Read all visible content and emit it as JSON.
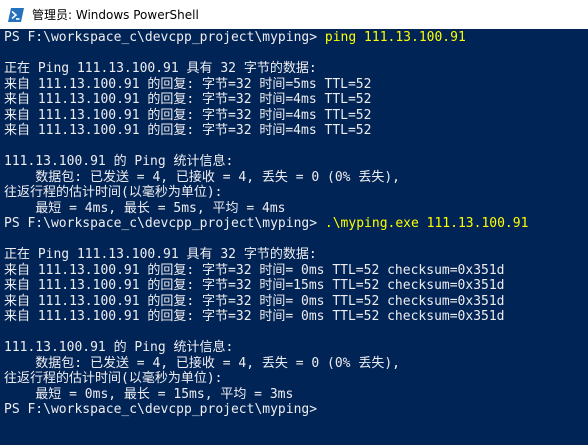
{
  "window": {
    "title": "管理员: Windows PowerShell",
    "icon": "powershell-icon",
    "colors": {
      "background": "#012456",
      "text": "#eeedf0",
      "command": "#ffff00"
    }
  },
  "console": {
    "lines": [
      {
        "prompt": "PS F:\\workspace_c\\devcpp_project\\myping>",
        "cmd": " ping 111.13.100.91"
      },
      {
        "text": ""
      },
      {
        "text": "正在 Ping 111.13.100.91 具有 32 字节的数据:"
      },
      {
        "text": "来自 111.13.100.91 的回复: 字节=32 时间=5ms TTL=52"
      },
      {
        "text": "来自 111.13.100.91 的回复: 字节=32 时间=4ms TTL=52"
      },
      {
        "text": "来自 111.13.100.91 的回复: 字节=32 时间=4ms TTL=52"
      },
      {
        "text": "来自 111.13.100.91 的回复: 字节=32 时间=4ms TTL=52"
      },
      {
        "text": ""
      },
      {
        "text": "111.13.100.91 的 Ping 统计信息:"
      },
      {
        "text": "    数据包: 已发送 = 4, 已接收 = 4, 丢失 = 0 (0% 丢失),"
      },
      {
        "text": "往返行程的估计时间(以毫秒为单位):"
      },
      {
        "text": "    最短 = 4ms, 最长 = 5ms, 平均 = 4ms"
      },
      {
        "prompt": "PS F:\\workspace_c\\devcpp_project\\myping>",
        "cmd": " .\\myping.exe 111.13.100.91"
      },
      {
        "text": ""
      },
      {
        "text": "正在 Ping 111.13.100.91 具有 32 字节的数据:"
      },
      {
        "text": "来自 111.13.100.91 的回复: 字节=32 时间= 0ms TTL=52 checksum=0x351d"
      },
      {
        "text": "来自 111.13.100.91 的回复: 字节=32 时间=15ms TTL=52 checksum=0x351d"
      },
      {
        "text": "来自 111.13.100.91 的回复: 字节=32 时间= 0ms TTL=52 checksum=0x351d"
      },
      {
        "text": "来自 111.13.100.91 的回复: 字节=32 时间= 0ms TTL=52 checksum=0x351d"
      },
      {
        "text": ""
      },
      {
        "text": "111.13.100.91 的 Ping 统计信息:"
      },
      {
        "text": "    数据包: 已发送 = 4, 已接收 = 4, 丢失 = 0 (0% 丢失),"
      },
      {
        "text": "往返行程的估计时间(以毫秒为单位):"
      },
      {
        "text": "    最短 = 0ms, 最长 = 15ms, 平均 = 3ms"
      },
      {
        "prompt": "PS F:\\workspace_c\\devcpp_project\\myping>",
        "cmd": ""
      }
    ]
  }
}
